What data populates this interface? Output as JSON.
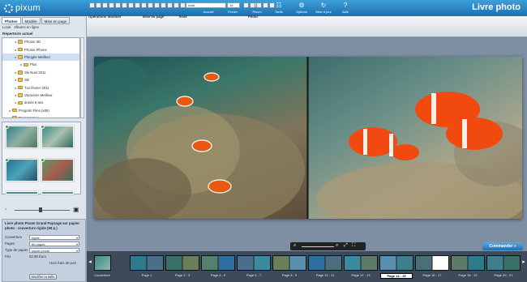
{
  "app": {
    "logo": "pixum",
    "title": "Livre photo"
  },
  "menu": [
    {
      "label": "Accueil",
      "icon": "home-icon",
      "glyph": "⌂"
    },
    {
      "label": "Fichier",
      "icon": "monitor-icon",
      "glyph": "▭"
    },
    {
      "label": "Pixum",
      "icon": "cart-icon",
      "glyph": "⛟"
    },
    {
      "label": "Tarifs",
      "icon": "people-icon",
      "glyph": "☷"
    },
    {
      "label": "Options",
      "icon": "gear-icon",
      "glyph": "⚙"
    },
    {
      "label": "Mise à jour",
      "icon": "refresh-icon",
      "glyph": "↻"
    },
    {
      "label": "Aide",
      "icon": "help-icon",
      "glyph": "?"
    }
  ],
  "left": {
    "tabs": [
      "Photos",
      "Modèle",
      "Mise en page"
    ],
    "subtabs": [
      "Local",
      "Albums en ligne"
    ],
    "dir_label": "Répertoire actuel",
    "tree": [
      {
        "label": "Photos 3D",
        "indent": 2,
        "selected": false
      },
      {
        "label": "Photos iPhone",
        "indent": 2,
        "selected": false
      },
      {
        "label": "Plongée Meilleur",
        "indent": 2,
        "selected": true
      },
      {
        "label": "Plus",
        "indent": 3,
        "selected": false
      },
      {
        "label": "Ski Noel 2011",
        "indent": 2,
        "selected": false
      },
      {
        "label": "Ski",
        "indent": 2,
        "selected": false
      },
      {
        "label": "Tux février 2011",
        "indent": 2,
        "selected": false
      },
      {
        "label": "Vacances Meilleur",
        "indent": 2,
        "selected": false
      },
      {
        "label": "annés 9 ans",
        "indent": 2,
        "selected": false
      },
      {
        "label": "Program Files (x86)",
        "indent": 1,
        "selected": false
      },
      {
        "label": "Programmes",
        "indent": 1,
        "selected": false
      }
    ],
    "info_title": "Livre photo Pixum Grand Paysage sur papier photo - couverture rigide (68 p.)",
    "fields": [
      {
        "key": "Couverture",
        "value": "rigide"
      },
      {
        "key": "Pages",
        "value": "66 pages"
      },
      {
        "key": "Type de papier",
        "value": "papier photo"
      },
      {
        "key": "Prix",
        "value": "52,95 Euro"
      }
    ],
    "shipping_note": "Hors frais de port",
    "modify_button": "Modifier la taille"
  },
  "toolbar": {
    "groups": [
      "Opérations",
      "Modifier",
      "Mise en page",
      "Texte",
      "Photo"
    ],
    "font": "Arial",
    "font_size": "16"
  },
  "order_button": "Commander »",
  "filmstrip": {
    "labels": [
      "Couverture",
      "Page 1",
      "Page 2 - 3",
      "Page 4 - 5",
      "Page 6 - 7",
      "Page 8 - 9",
      "Page 10 - 11",
      "Page 12 - 13",
      "Page 14 - 15",
      "Page 16 - 17",
      "Page 18 - 19",
      "Page 20 - 21"
    ],
    "current": "Page 14 - 15"
  },
  "colors": {
    "header": "#2a88cc",
    "accent": "#1f6fb2",
    "filmstrip": "#3c4a59"
  }
}
